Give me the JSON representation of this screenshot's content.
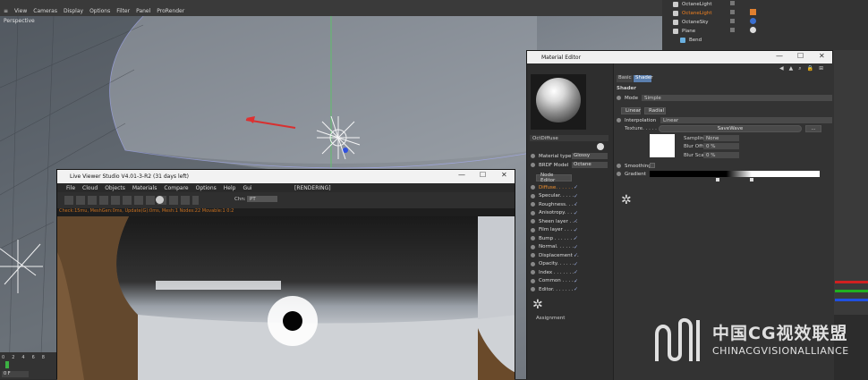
{
  "c4d": {
    "menu": [
      "≡",
      "View",
      "Cameras",
      "Display",
      "Options",
      "Filter",
      "Panel",
      "ProRender"
    ],
    "viewport_label": "Perspective",
    "timeline": [
      "0",
      "2",
      "4",
      "6",
      "8"
    ],
    "frame_field": "0 F"
  },
  "object_manager": {
    "items": [
      {
        "name": "OctaneLight",
        "selected": false
      },
      {
        "name": "OctaneLight",
        "selected": true
      },
      {
        "name": "OctaneSky",
        "selected": false
      },
      {
        "name": "Plane",
        "selected": false
      },
      {
        "name": "Bend",
        "selected": false
      }
    ]
  },
  "material_editor": {
    "title": "Material Editor",
    "material_name": "OctDiffuse",
    "tabs": [
      "Basic",
      "Shader"
    ],
    "active_tab": "Shader",
    "section": "Shader",
    "mode_label": "Mode",
    "mode_value": "Simple",
    "linear_button": "Linear",
    "radial_button": "Radial",
    "interpolation_label": "Interpolation",
    "interpolation_value": "Linear",
    "texture_label": "Texture. . . . . .",
    "sample_label": "SaveWave",
    "sampling_label": "Sampling",
    "sampling_value": "None",
    "blur_offset_label": "Blur Offset",
    "blur_offset_value": "0 %",
    "blur_scale_label": "Blur Scale",
    "blur_scale_value": "0 %",
    "smoothing_label": "Smoothing",
    "gradient_label": "Gradient",
    "material_type_label": "Material type",
    "material_type_value": "Glossy",
    "brdf_label": "BRDF Model",
    "brdf_value": "Octane",
    "node_editor_button": "Node Editor",
    "channels": [
      {
        "name": "Diffuse. . . . . .",
        "active": true
      },
      {
        "name": "Specular. . . . .",
        "active": false
      },
      {
        "name": "Roughness. . . .",
        "active": false
      },
      {
        "name": "Anisotropy. . . .",
        "active": false
      },
      {
        "name": "Sheen layer . . .",
        "active": false
      },
      {
        "name": "Film layer . . . .",
        "active": false
      },
      {
        "name": "Bump . . . . . . .",
        "active": false
      },
      {
        "name": "Normal. . . . . .",
        "active": false
      },
      {
        "name": "Displacement . .",
        "active": false
      },
      {
        "name": "Opacity. . . . . .",
        "active": false
      },
      {
        "name": "Index . . . . . . .",
        "active": false
      },
      {
        "name": "Common . . . . .",
        "active": false
      },
      {
        "name": "Editor. . . . . . .",
        "active": false
      }
    ],
    "assignment_label": "Assignment"
  },
  "live_viewer": {
    "title": "Live Viewer Studio V4.01-3-R2 (31 days left)",
    "menu": [
      "File",
      "Cloud",
      "Objects",
      "Materials",
      "Compare",
      "Options",
      "Help",
      "Gui"
    ],
    "render_status": "[RENDERING]",
    "channel_label": "Chn:",
    "channel_value": "PT",
    "status_text": "Check:15mu, MeshGen:0ms, Update(G):0ms, Mesh:1 Nodes:22 Movable:1 0:2"
  },
  "watermark": {
    "cn": "中国CG视效联盟",
    "en": "CHINACGVISIONALLIANCE"
  }
}
